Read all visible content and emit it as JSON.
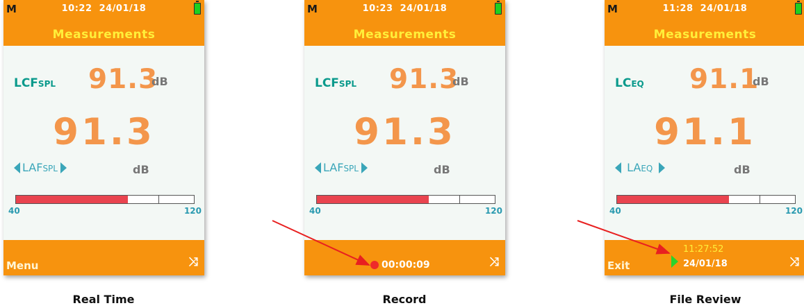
{
  "screens": [
    {
      "mode": "M",
      "time": "10:22",
      "date": "24/01/18",
      "title": "Measurements",
      "param1": {
        "name": "LCF",
        "sub": "SPL",
        "value": "91.3",
        "unit": "dB"
      },
      "big_value": "91.3",
      "param2": {
        "name": "LAF",
        "sub": "SPL",
        "unit": "dB"
      },
      "bar": {
        "min": "40",
        "max": "120",
        "level": 0.63
      },
      "footer_left": "Menu",
      "footer_right": "⤨",
      "caption": "Real Time"
    },
    {
      "mode": "M",
      "time": "10:23",
      "date": "24/01/18",
      "title": "Measurements",
      "param1": {
        "name": "LCF",
        "sub": "SPL",
        "value": "91.3",
        "unit": "dB"
      },
      "big_value": "91.3",
      "param2": {
        "name": "LAF",
        "sub": "SPL",
        "unit": "dB"
      },
      "bar": {
        "min": "40",
        "max": "120",
        "level": 0.63
      },
      "record_time": "00:00:09",
      "footer_right": "⤨",
      "caption": "Record"
    },
    {
      "mode": "M",
      "time": "11:28",
      "date": "24/01/18",
      "title": "Measurements",
      "param1": {
        "name": "LC",
        "sub": "EQ",
        "value": "91.1",
        "unit": "dB"
      },
      "big_value": "91.1",
      "param2": {
        "name": "LA",
        "sub": "EQ",
        "unit": "dB"
      },
      "bar": {
        "min": "40",
        "max": "120",
        "level": 0.63
      },
      "footer_left": "Exit",
      "review_time": "11:27:52",
      "review_date": "24/01/18",
      "footer_right": "⤨",
      "caption": "File Review"
    }
  ],
  "colors": {
    "header": "#f7930e",
    "value": "#f3964b",
    "bar_fill": "#e9444f",
    "arrow": "#e82020"
  }
}
